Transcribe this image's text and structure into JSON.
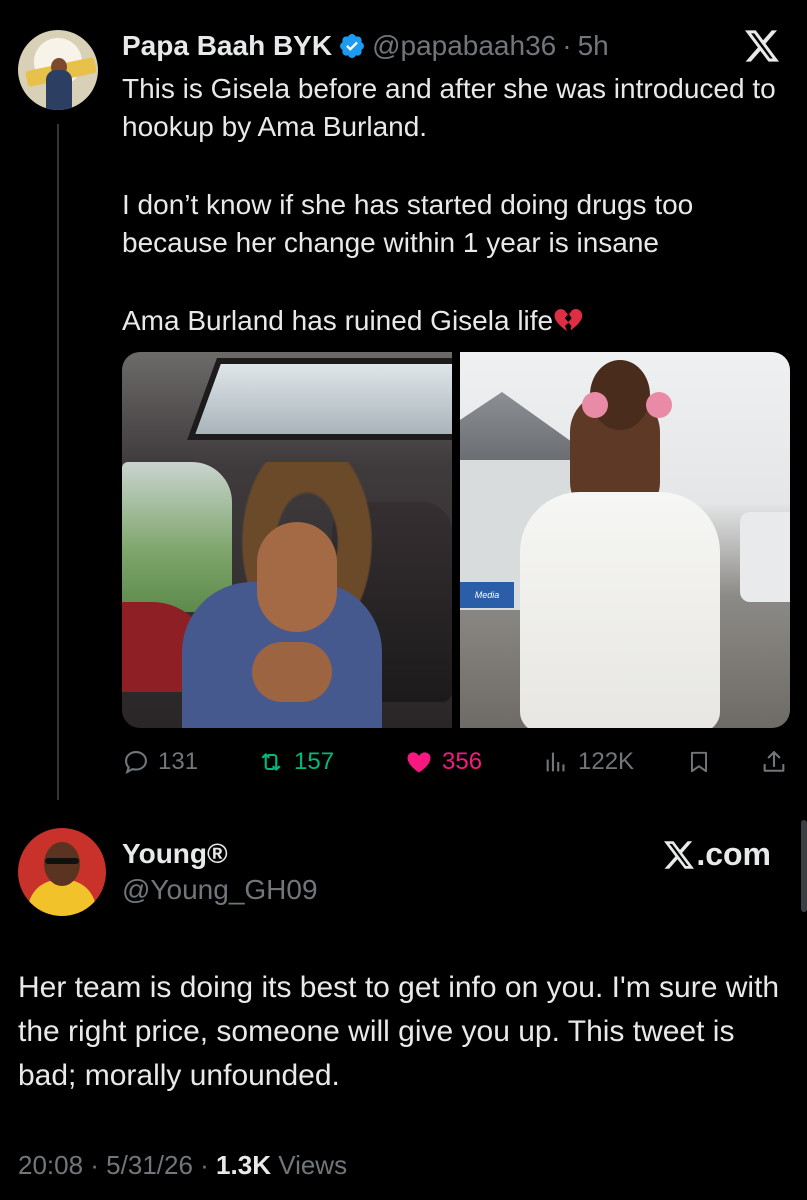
{
  "quoted_tweet": {
    "display_name": "Papa Baah BYK",
    "handle": "@papabaah36",
    "separator": "·",
    "time": "5h",
    "text_lines": [
      "This is Gisela before and after she was introduced to hookup by Ama Burland.",
      "I don’t know if she has started doing drugs too because her change within 1 year is insane",
      "Ama Burland has ruined Gisela life"
    ],
    "emoji": "broken-heart-icon",
    "media_badge": "Media",
    "stats": {
      "replies": "131",
      "retweets": "157",
      "likes": "356",
      "views": "122K"
    }
  },
  "reply": {
    "display_name": "Young®",
    "handle": "@Young_GH09",
    "source_link": ".com",
    "text": "Her team is doing its best to get info on you. I'm sure with the right price, someone will give you up. This tweet is bad; morally unfounded.",
    "timestamp": "20:08 · 5/31/26 ·",
    "views_count": "1.3K",
    "views_label": "Views"
  },
  "colors": {
    "background": "#000000",
    "text_primary": "#e7e9ea",
    "text_secondary": "#71767b",
    "verified": "#1d9bf0",
    "retweet": "#00ba7c",
    "like": "#f91880"
  }
}
